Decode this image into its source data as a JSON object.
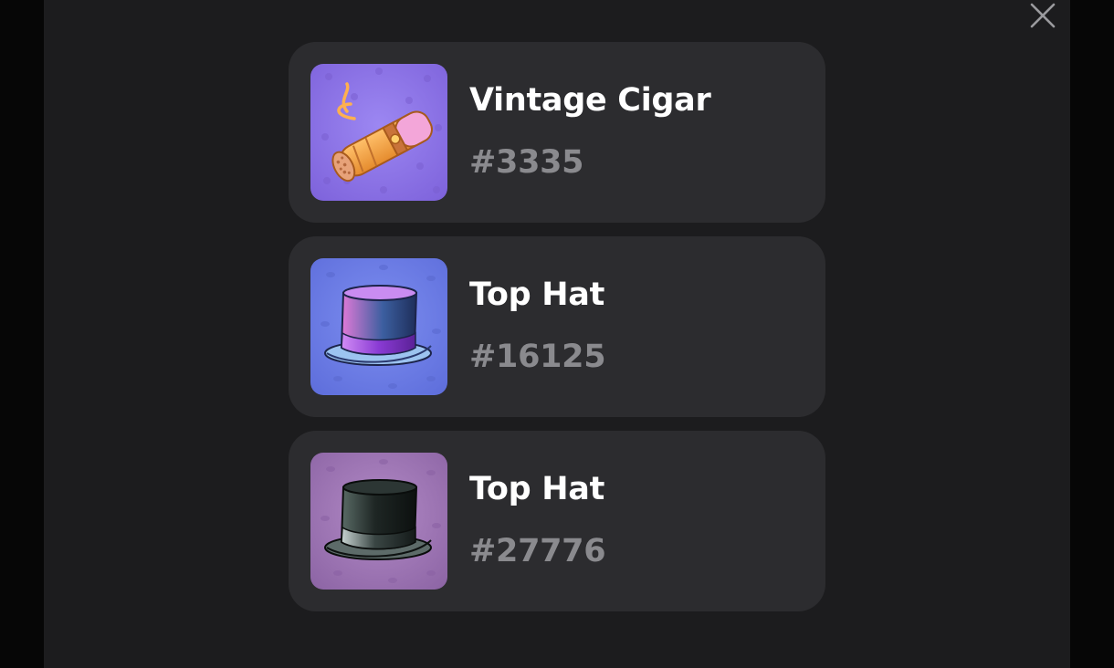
{
  "modal": {
    "close_icon": "close-icon"
  },
  "items": [
    {
      "name": "Vintage Cigar",
      "number": "#3335",
      "icon": "cigar-icon",
      "background_color": "#8d77e8"
    },
    {
      "name": "Top Hat",
      "number": "#16125",
      "icon": "top-hat-icon",
      "background_color": "#6a7ce6"
    },
    {
      "name": "Top Hat",
      "number": "#27776",
      "icon": "top-hat-icon",
      "background_color": "#a07ab8"
    }
  ],
  "colors": {
    "modal_background": "#1c1c1e",
    "card_background": "#2c2c2f",
    "title_text": "#ffffff",
    "number_text": "#8a8a8e"
  }
}
